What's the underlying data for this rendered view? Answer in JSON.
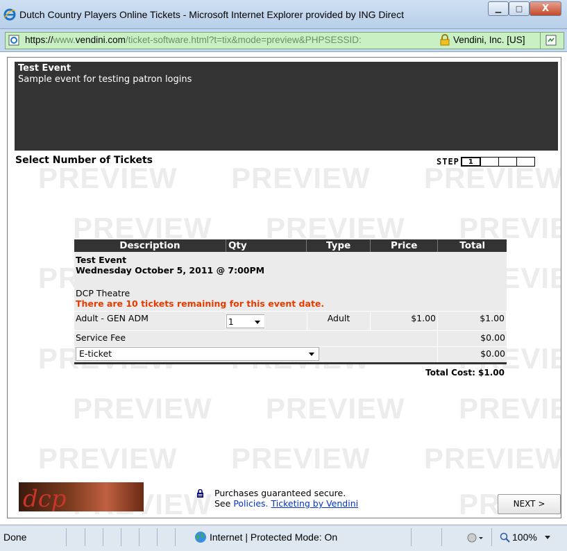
{
  "window": {
    "title": "Dutch Country Players Online Tickets - Microsoft Internet Explorer provided by ING Direct",
    "minimize": "▁",
    "maximize": "□",
    "close": "X"
  },
  "address": {
    "scheme": "https://",
    "prefix": "www.",
    "host": "vendini.com",
    "path": "/ticket-software.html?t=tix&mode=preview&PHPSESSID:",
    "certificate": "Vendini, Inc. [US]"
  },
  "event": {
    "name": "Test Event",
    "description": "Sample event for testing patron logins"
  },
  "page": {
    "section_title": "Select Number of Tickets",
    "step_label": "STEP",
    "steps": [
      "1",
      "",
      "",
      ""
    ],
    "watermark": "PREVIEW"
  },
  "table": {
    "headers": {
      "description": "Description",
      "qty": "Qty",
      "type": "Type",
      "price": "Price",
      "total": "Total"
    },
    "event_title": "Test Event",
    "event_date": "Wednesday October 5, 2011 @ 7:00PM",
    "venue": "DCP Theatre",
    "remaining": "There are 10 tickets remaining for this event date.",
    "ticket_row": {
      "description": "Adult - GEN ADM",
      "qty": "1",
      "type": "Adult",
      "price": "$1.00",
      "total": "$1.00"
    },
    "fee_row": {
      "description": "Service Fee",
      "total": "$0.00"
    },
    "delivery_row": {
      "selected": "E-ticket",
      "total": "$0.00"
    },
    "total_cost": "Total Cost: $1.00"
  },
  "footer": {
    "logo_text": "dcp",
    "secure_text": "Purchases guaranteed secure.",
    "see": "See",
    "policies_link": "Policies.",
    "vendini_link": "Ticketing by Vendini",
    "next_button": "NEXT >"
  },
  "status": {
    "text": "Done",
    "zone": "Internet | Protected Mode: On",
    "zoom": "100%"
  },
  "colors": {
    "header_bg": "#333333",
    "remaining_text": "#e63c00",
    "link": "#0033cc",
    "secure_address": "#c8f0c2"
  }
}
